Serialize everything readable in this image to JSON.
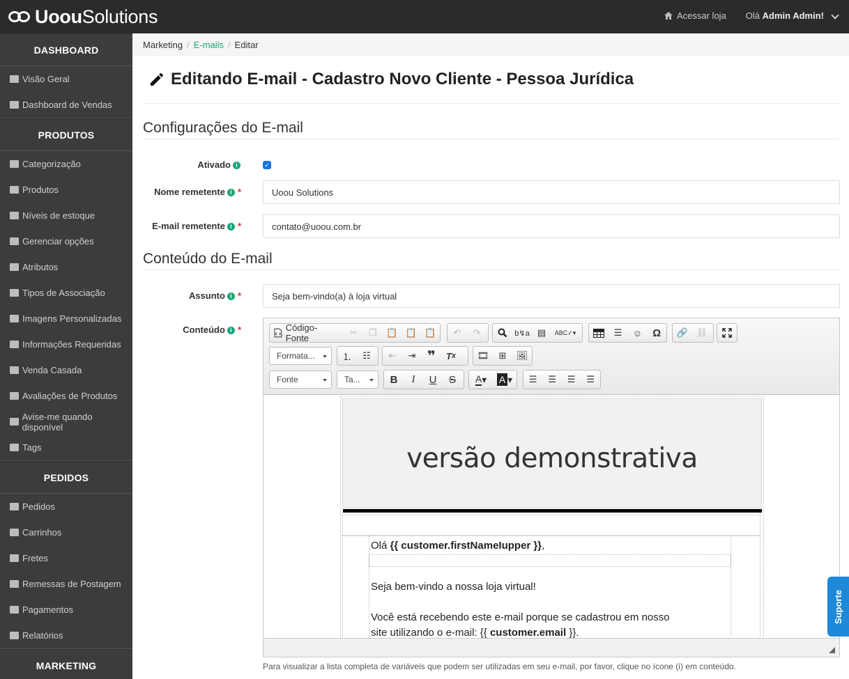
{
  "header": {
    "logo_bold": "Uoou",
    "logo_rest": "Solutions",
    "store_link": "Acessar loja",
    "greeting_prefix": "Olá",
    "user_name": "Admin Admin!"
  },
  "sidebar": {
    "sections": [
      {
        "title": "DASHBOARD",
        "items": [
          {
            "label": "Visão Geral",
            "icon": "dashboard-icon"
          },
          {
            "label": "Dashboard de Vendas",
            "icon": "dashboard-icon"
          }
        ]
      },
      {
        "title": "PRODUTOS",
        "items": [
          {
            "label": "Categorização",
            "icon": "folder-icon"
          },
          {
            "label": "Produtos",
            "icon": "list-icon"
          },
          {
            "label": "Níveis de estoque",
            "icon": "cubes-icon"
          },
          {
            "label": "Gerenciar opções",
            "icon": "grid-icon"
          },
          {
            "label": "Atributos",
            "icon": "list-alt-icon"
          },
          {
            "label": "Tipos de Associação",
            "icon": "list-alt-icon"
          },
          {
            "label": "Imagens Personalizadas",
            "icon": "image-icon"
          },
          {
            "label": "Informações Requeridas",
            "icon": "font-icon"
          },
          {
            "label": "Venda Casada",
            "icon": "random-icon"
          },
          {
            "label": "Avaliações de Produtos",
            "icon": "star-icon"
          },
          {
            "label": "Avise-me quando disponível",
            "icon": "clock-icon"
          },
          {
            "label": "Tags",
            "icon": "tag-icon"
          }
        ]
      },
      {
        "title": "PEDIDOS",
        "items": [
          {
            "label": "Pedidos",
            "icon": "cart-icon"
          },
          {
            "label": "Carrinhos",
            "icon": "cart-icon"
          },
          {
            "label": "Fretes",
            "icon": "truck-icon"
          },
          {
            "label": "Remessas de Postagem",
            "icon": "truck-icon"
          },
          {
            "label": "Pagamentos",
            "icon": "credit-card-icon"
          },
          {
            "label": "Relatórios",
            "icon": "bar-chart-icon"
          }
        ]
      },
      {
        "title": "MARKETING",
        "items": []
      }
    ]
  },
  "breadcrumb": {
    "items": [
      "Marketing",
      "E-mails",
      "Editar"
    ],
    "sep": "/"
  },
  "page": {
    "title": "Editando E-mail - Cadastro Novo Cliente - Pessoa Jurídica",
    "section_config": "Configurações do E-mail",
    "section_content": "Conteúdo do E-mail"
  },
  "form": {
    "ativado_label": "Ativado",
    "ativado_checked": true,
    "nome_label": "Nome remetente",
    "nome_value": "Uoou Solutions",
    "email_label": "E-mail remetente",
    "email_value": "contato@uoou.com.br",
    "assunto_label": "Assunto",
    "assunto_value": "Seja bem-vindo(a) à loja virtual",
    "conteudo_label": "Conteúdo",
    "required_mark": "*",
    "info_mark": "i"
  },
  "editor": {
    "source_label": "Código-Fonte",
    "format_combo": "Formata...",
    "font_combo": "Fonte",
    "size_combo": "Ta...",
    "demo_banner": "versão demonstrativa",
    "greeting_prefix": "Olá",
    "greeting_var": "{{ customer.firstNameIupper }}",
    "greeting_suffix": ",",
    "welcome": "Seja bem-vindo a nossa loja virtual!",
    "body_line1": "Você está recebendo este e-mail porque se cadastrou em nosso",
    "body_line2_prefix": "site utilizando o e-mail: {{",
    "body_line2_var": "customer.email",
    "body_line2_suffix": "}}."
  },
  "help_text": "Para visualizar a lista completa de variáveis que podem ser utilizadas em seu e-mail, por favor, clique no ícone (i) em conteúdo.",
  "support_tab": "Suporte"
}
